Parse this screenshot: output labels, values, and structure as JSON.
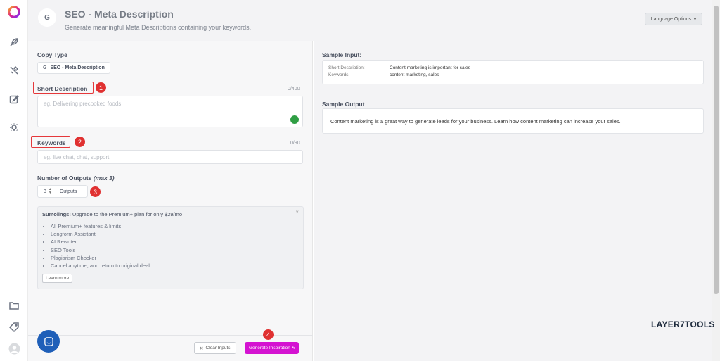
{
  "header": {
    "badge": "G",
    "title": "SEO - Meta Description",
    "subtitle": "Generate meaningful Meta Descriptions containing your keywords.",
    "language_button": "Language Options"
  },
  "form": {
    "copy_type_label": "Copy Type",
    "copy_type_chip_icon": "G",
    "copy_type_value": "SEO - Meta Description",
    "short_description_label": "Short Description",
    "short_description_counter": "0/400",
    "short_description_placeholder": "eg. Delivering precooked foods",
    "keywords_label": "Keywords",
    "keywords_counter": "0/90",
    "keywords_placeholder": "eg. live chat, chat, support",
    "outputs_label": "Number of Outputs",
    "outputs_hint": "(max 3)",
    "outputs_value": "3",
    "outputs_unit": "Outputs",
    "badges": [
      "1",
      "2",
      "3",
      "4"
    ]
  },
  "promo": {
    "brand": "Sumolings!",
    "headline": " Upgrade to the Premium+ plan for only $29/mo",
    "close": "×",
    "features": [
      "All Premium+ features & limits",
      "Longform Assistant",
      "AI Rewriter",
      "SEO Tools",
      "Plagiarism Checker",
      "Cancel anytime, and return to original deal"
    ],
    "learn_more": "Learn more"
  },
  "actions": {
    "clear_label": "Clear Inputs",
    "generate_label": "Generate Inspiration"
  },
  "sample": {
    "input_label": "Sample Input:",
    "short_description_key": "Short Description:",
    "short_description_value": "Content marketing is important for sales",
    "keywords_key": "Keywords:",
    "keywords_value": "content marketing, sales",
    "output_label": "Sample Output",
    "output_text": "Content marketing is a great way to generate leads for your business. Learn how content marketing can increase your sales."
  },
  "watermark": "LAYER7TOOLS",
  "sidebar_icons": [
    "logo-icon",
    "feather-icon",
    "tools-icon",
    "edit-icon",
    "bulb-icon",
    "folder-icon",
    "tag-icon",
    "avatar"
  ],
  "colors": {
    "accent": "#d413d1",
    "badge_red": "#e03131",
    "chat_blue": "#1f5fb8"
  }
}
